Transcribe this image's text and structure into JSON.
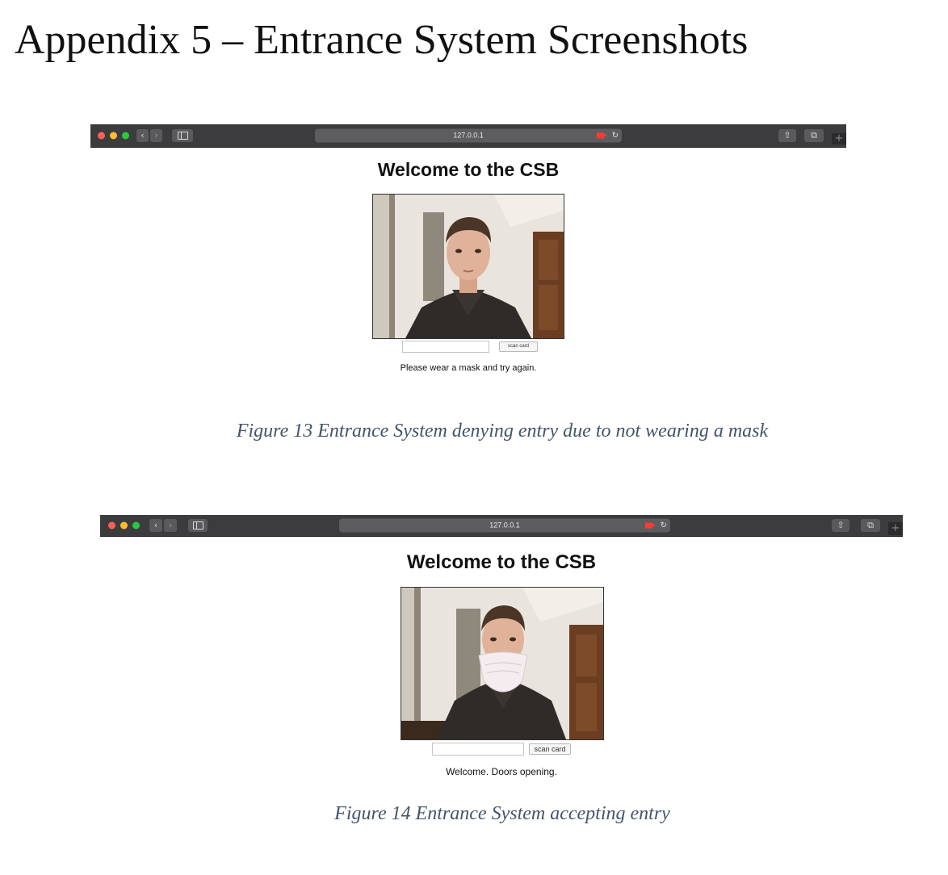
{
  "page": {
    "heading": "Appendix 5 – Entrance System Screenshots"
  },
  "screenshots": [
    {
      "browser": {
        "url": "127.0.0.1",
        "nav_back_icon": "chevron-left-icon",
        "nav_forward_icon": "chevron-right-icon",
        "sidebar_icon": "sidebar-icon",
        "camera_icon": "camera-recording-icon",
        "reload_icon": "reload-icon",
        "share_icon": "share-icon",
        "tabs_icon": "tabs-overview-icon",
        "newtab_icon": "plus-icon",
        "toolbar_color": "#3c3c3e"
      },
      "site": {
        "title": "Welcome to the CSB",
        "card_input_value": "",
        "scan_button_label": "scan card",
        "status_message": "Please wear a mask and try again."
      },
      "webcam": {
        "subject_wearing_mask": false
      },
      "caption": "Figure 13 Entrance System denying entry due to not wearing a mask"
    },
    {
      "browser": {
        "url": "127.0.0.1",
        "nav_back_icon": "chevron-left-icon",
        "nav_forward_icon": "chevron-right-icon",
        "sidebar_icon": "sidebar-icon",
        "camera_icon": "camera-recording-icon",
        "reload_icon": "reload-icon",
        "share_icon": "share-icon",
        "tabs_icon": "tabs-overview-icon",
        "newtab_icon": "plus-icon",
        "toolbar_color": "#3c3c3e"
      },
      "site": {
        "title": "Welcome to the CSB",
        "card_input_value": "",
        "scan_button_label": "scan card",
        "status_message": "Welcome. Doors opening."
      },
      "webcam": {
        "subject_wearing_mask": true
      },
      "caption": "Figure 14 Entrance System accepting entry"
    }
  ],
  "colors": {
    "caption_text": "#44546a",
    "traffic_red": "#ff5f57",
    "traffic_yellow": "#febc2e",
    "traffic_green": "#28c840",
    "recording_red": "#ff3b30"
  }
}
